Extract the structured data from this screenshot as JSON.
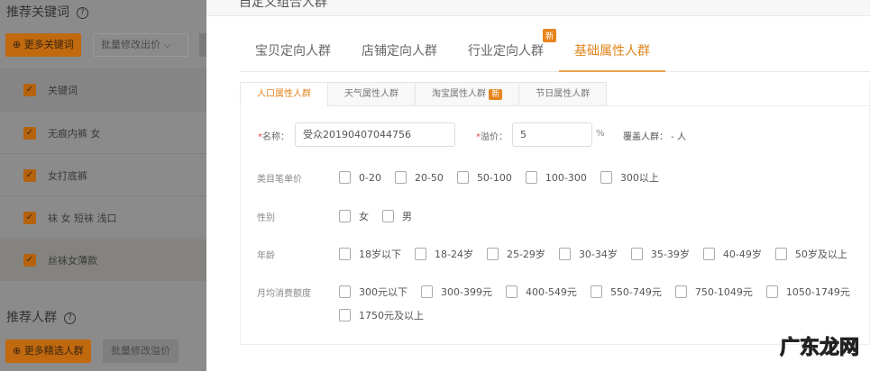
{
  "left": {
    "keywords_title": "推荐关键词",
    "more_keywords": "⊕ 更多关键词",
    "batch_bid": "批量修改出价",
    "header": "关键词",
    "keywords": [
      "无痕内裤 女",
      "女打底裤",
      "袜 女 短袜 浅口",
      "丝袜女薄款"
    ],
    "crowd_title": "推荐人群",
    "more_crowds": "⊕ 更多精选人群",
    "batch_premium": "批量修改溢价",
    "help": "?"
  },
  "modal": {
    "title": "自定义组合人群",
    "tabs": [
      {
        "label": "宝贝定向人群"
      },
      {
        "label": "店铺定向人群"
      },
      {
        "label": "行业定向人群",
        "badge": "新"
      },
      {
        "label": "基础属性人群"
      }
    ],
    "subtabs": [
      {
        "label": "人口属性人群"
      },
      {
        "label": "天气属性人群"
      },
      {
        "label": "淘宝属性人群",
        "badge": "新"
      },
      {
        "label": "节日属性人群"
      }
    ],
    "form": {
      "name_label": "名称：",
      "name_value": "受众20190407044756",
      "premium_label": "溢价：",
      "premium_value": "5",
      "percent": "%",
      "coverage": "覆盖人群： -  人",
      "price_label": "类目笔单价",
      "price_opts": [
        "0-20",
        "20-50",
        "50-100",
        "100-300",
        "300以上"
      ],
      "gender_label": "性别",
      "gender_opts": [
        "女",
        "男"
      ],
      "age_label": "年龄",
      "age_opts": [
        "18岁以下",
        "18-24岁",
        "25-29岁",
        "30-34岁",
        "35-39岁",
        "40-49岁",
        "50岁及以上"
      ],
      "spend_label": "月均消费额度",
      "spend_opts": [
        "300元以下",
        "300-399元",
        "400-549元",
        "550-749元",
        "750-1049元",
        "1050-1749元",
        "1750元及以上"
      ]
    }
  },
  "watermark": "广东龙网"
}
